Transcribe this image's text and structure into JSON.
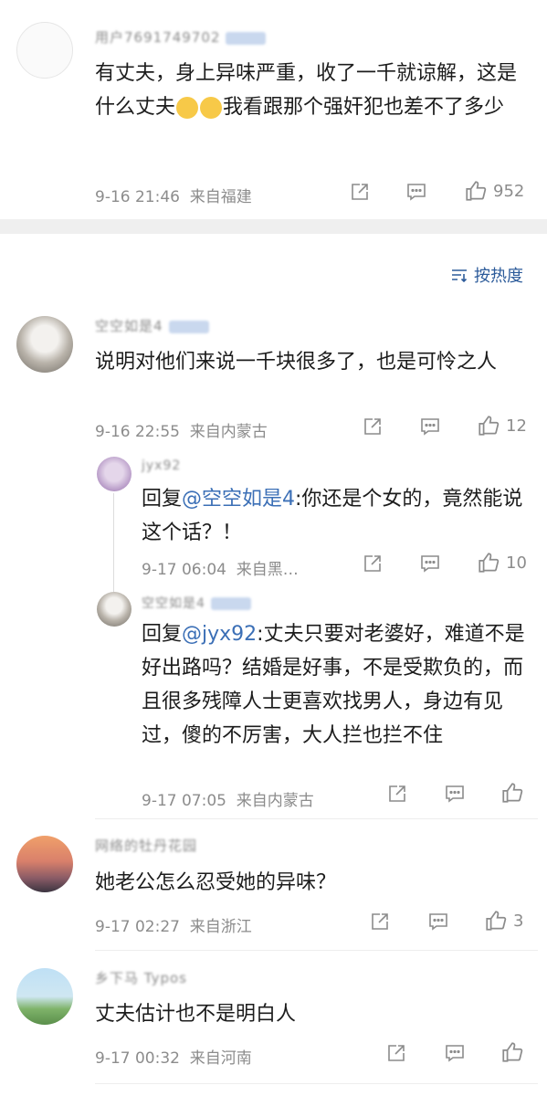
{
  "sort": {
    "label": "按热度"
  },
  "comments": [
    {
      "username": "用户7691749702",
      "text": "有丈夫，身上异味严重，收了一千就谅解，这是什么丈夫",
      "text_after_emoji": "我看跟那个强奸犯也差不了多少",
      "time": "9-16 21:46",
      "location": "来自福建",
      "likes": "952"
    },
    {
      "username": "空空如是4",
      "text": "说明对他们来说一千块很多了，也是可怜之人",
      "time": "9-16 22:55",
      "location": "来自内蒙古",
      "likes": "12",
      "replies": [
        {
          "username": "jyx92",
          "reply_prefix": "回复",
          "mention": "@空空如是4",
          "text": ":你还是个女的，竟然能说这个话？！",
          "time": "9-17 06:04",
          "location": "来自黑…",
          "likes": "10"
        },
        {
          "username": "空空如是4",
          "reply_prefix": "回复",
          "mention": "@jyx92",
          "text": ":丈夫只要对老婆好，难道不是好出路吗？结婚是好事，不是受欺负的，而且很多残障人士更喜欢找男人，身边有见过，傻的不厉害，大人拦也拦不住",
          "time": "9-17 07:05",
          "location": "来自内蒙古",
          "likes": ""
        }
      ]
    },
    {
      "username": "网络的牡丹花园",
      "text": "她老公怎么忍受她的异味？",
      "time": "9-17 02:27",
      "location": "来自浙江",
      "likes": "3"
    },
    {
      "username": "乡下马 Typos",
      "text": "丈夫估计也不是明白人",
      "time": "9-17 00:32",
      "location": "来自河南",
      "likes": ""
    }
  ]
}
